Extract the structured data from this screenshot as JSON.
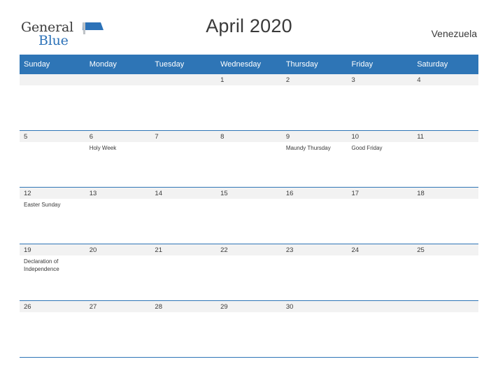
{
  "logo": {
    "word_one": "General",
    "word_two": "Blue",
    "flag_icon": "flag-icon"
  },
  "header": {
    "title": "April 2020",
    "country": "Venezuela"
  },
  "colors": {
    "header_blue": "#2e75b6",
    "logo_blue": "#2c72b8",
    "row_band": "#f2f2f2",
    "text": "#3a3a3a"
  },
  "calendar": {
    "weekday_headers": [
      "Sunday",
      "Monday",
      "Tuesday",
      "Wednesday",
      "Thursday",
      "Friday",
      "Saturday"
    ],
    "weeks": [
      [
        {
          "day": "",
          "event": ""
        },
        {
          "day": "",
          "event": ""
        },
        {
          "day": "",
          "event": ""
        },
        {
          "day": "1",
          "event": ""
        },
        {
          "day": "2",
          "event": ""
        },
        {
          "day": "3",
          "event": ""
        },
        {
          "day": "4",
          "event": ""
        }
      ],
      [
        {
          "day": "5",
          "event": ""
        },
        {
          "day": "6",
          "event": "Holy Week"
        },
        {
          "day": "7",
          "event": ""
        },
        {
          "day": "8",
          "event": ""
        },
        {
          "day": "9",
          "event": "Maundy Thursday"
        },
        {
          "day": "10",
          "event": "Good Friday"
        },
        {
          "day": "11",
          "event": ""
        }
      ],
      [
        {
          "day": "12",
          "event": "Easter Sunday"
        },
        {
          "day": "13",
          "event": ""
        },
        {
          "day": "14",
          "event": ""
        },
        {
          "day": "15",
          "event": ""
        },
        {
          "day": "16",
          "event": ""
        },
        {
          "day": "17",
          "event": ""
        },
        {
          "day": "18",
          "event": ""
        }
      ],
      [
        {
          "day": "19",
          "event": "Declaration of Independence"
        },
        {
          "day": "20",
          "event": ""
        },
        {
          "day": "21",
          "event": ""
        },
        {
          "day": "22",
          "event": ""
        },
        {
          "day": "23",
          "event": ""
        },
        {
          "day": "24",
          "event": ""
        },
        {
          "day": "25",
          "event": ""
        }
      ],
      [
        {
          "day": "26",
          "event": ""
        },
        {
          "day": "27",
          "event": ""
        },
        {
          "day": "28",
          "event": ""
        },
        {
          "day": "29",
          "event": ""
        },
        {
          "day": "30",
          "event": ""
        },
        {
          "day": "",
          "event": ""
        },
        {
          "day": "",
          "event": ""
        }
      ]
    ]
  }
}
